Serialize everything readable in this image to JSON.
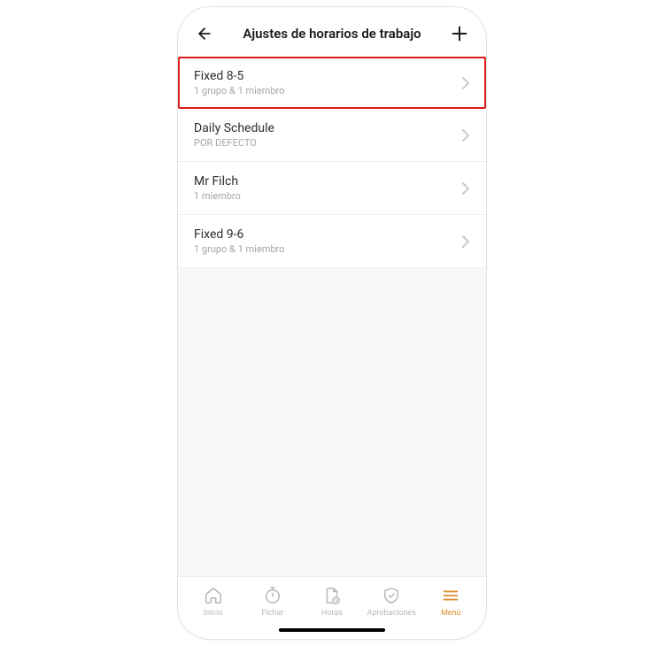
{
  "header": {
    "title": "Ajustes de horarios de trabajo"
  },
  "schedules": [
    {
      "label": "Fixed 8-5",
      "sub": "1 grupo & 1 miembro",
      "highlighted": true
    },
    {
      "label": "Daily Schedule",
      "sub": "POR DEFECTO",
      "highlighted": false
    },
    {
      "label": "Mr Filch",
      "sub": "1 miembro",
      "highlighted": false
    },
    {
      "label": "Fixed 9-6",
      "sub": "1 grupo & 1 miembro",
      "highlighted": false
    }
  ],
  "nav": {
    "home": "Inicio",
    "punch": "Fichar",
    "hours": "Horas",
    "approvals": "Aprobaciones",
    "menu": "Menú"
  }
}
